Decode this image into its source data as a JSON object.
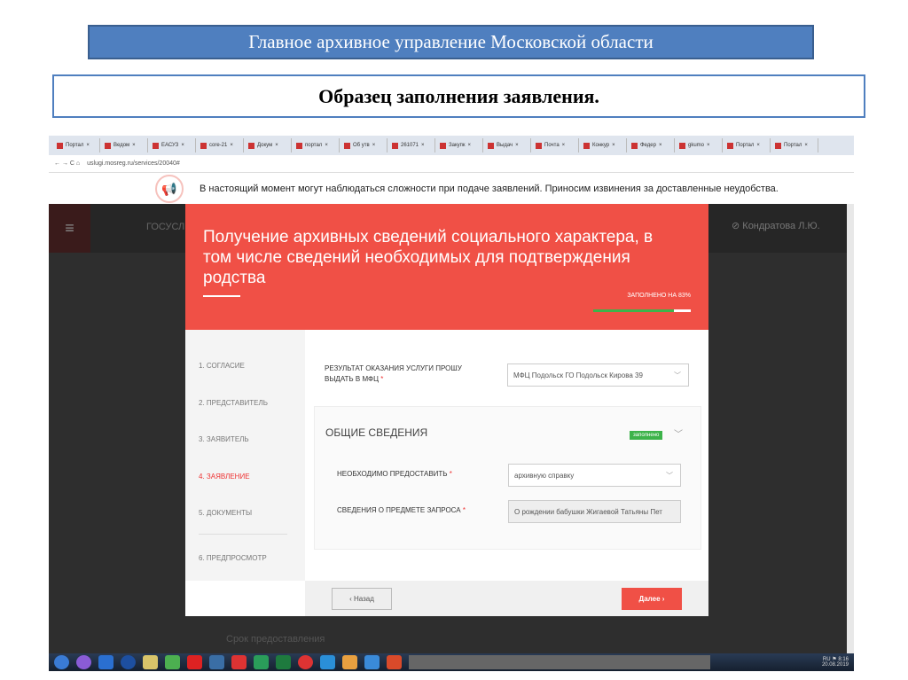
{
  "slide": {
    "title": "Главное архивное управление Московской области",
    "subtitle": "Образец заполнения заявления."
  },
  "browser": {
    "tabs": [
      "Портал",
      "Ведом",
      "ЕАСУЗ",
      "core-21",
      "Докум",
      "портал",
      "Об утв",
      "261071",
      "Закупк",
      "Выдач",
      "Почта",
      "Конкур",
      "Федер",
      "gkumo",
      "Портал",
      "Портал"
    ],
    "url": "uslugi.mosreg.ru/services/20040#"
  },
  "notice": "В настоящий момент могут наблюдаться сложности при подаче заявлений. Приносим извинения за доставленные неудобства.",
  "header": {
    "site": "ГОСУСЛ",
    "user": "Кондратова Л.Ю."
  },
  "modal": {
    "title": "Получение архивных сведений социального характера, в том числе сведений необходимых для подтверждения родства",
    "progress_label": "ЗАПОЛНЕНО НА 83%",
    "progress": 83,
    "steps": [
      "1.  СОГЛАСИЕ",
      "2.  ПРЕДСТАВИТЕЛЬ",
      "3.  ЗАЯВИТЕЛЬ",
      "4.  ЗАЯВЛЕНИЕ",
      "5.  ДОКУМЕНТЫ",
      "6.  ПРЕДПРОСМОТР"
    ],
    "result_label": "РЕЗУЛЬТАТ ОКАЗАНИЯ УСЛУГИ ПРОШУ ВЫДАТЬ В МФЦ",
    "result_value": "МФЦ Подольск ГО Подольск Кирова 39",
    "section_title": "ОБЩИЕ СВЕДЕНИЯ",
    "section_badge": "заполнено",
    "provide_label": "НЕОБХОДИМО ПРЕДОСТАВИТЬ",
    "provide_value": "архивную справку",
    "subject_label": "СВЕДЕНИЯ О ПРЕДМЕТЕ ЗАПРОСА",
    "subject_value": "О рождении бабушки Жигаевой Татьяны Пет",
    "back": "‹ Назад",
    "next": "Далее ›"
  },
  "below": "Срок предоставления",
  "taskbar": {
    "lang": "RU",
    "time": "8:16",
    "date": "20.08.2019"
  },
  "colors": {
    "brand": "#f05046",
    "success": "#3db34a",
    "slide_blue": "#4f7fbf"
  }
}
